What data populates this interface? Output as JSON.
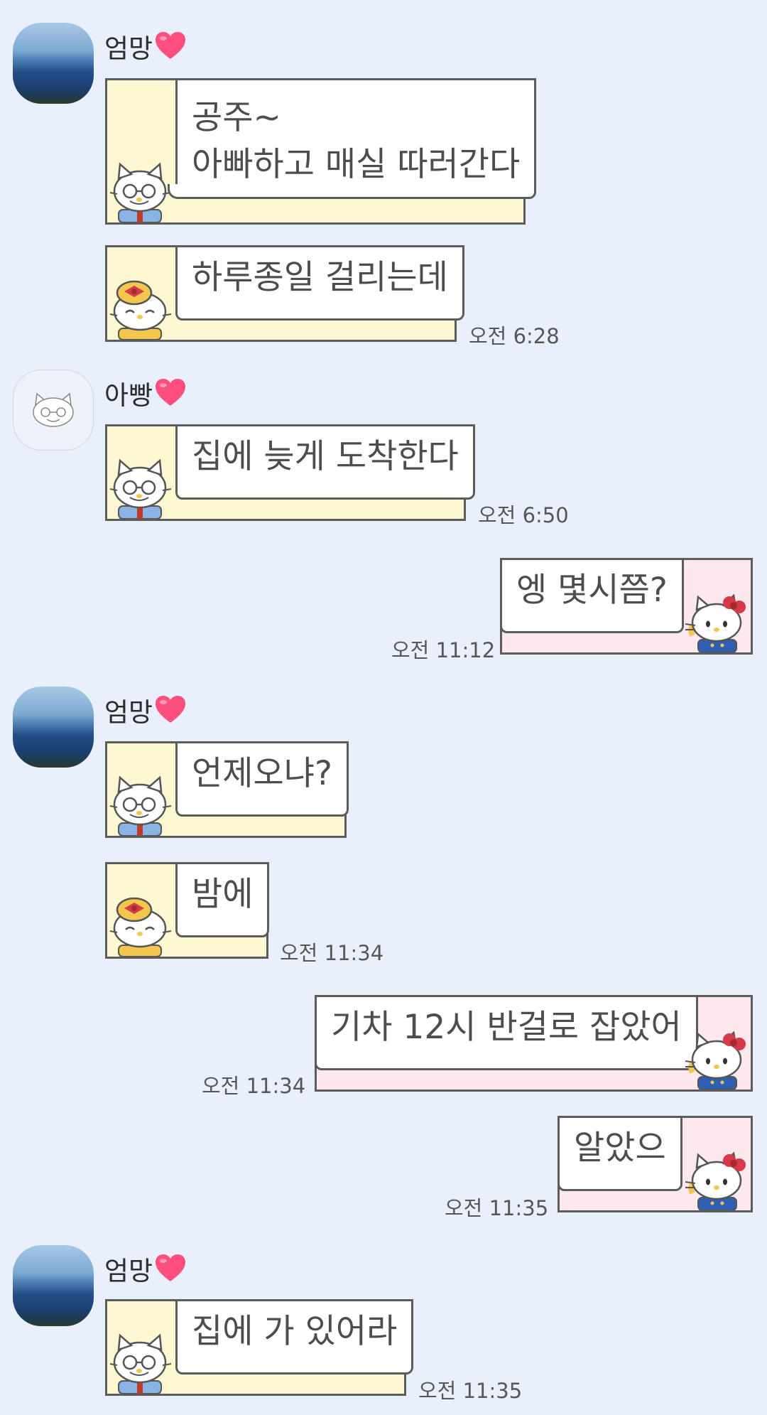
{
  "senders": {
    "mom": "엄망",
    "dad": "아빵"
  },
  "messages": [
    {
      "from": "mom",
      "text_lines": [
        "공주~",
        "아빠하고 매실 따러간다"
      ]
    },
    {
      "from": "mom",
      "text": "하루종일 걸리는데",
      "time": "오전 6:28"
    },
    {
      "from": "dad",
      "text": "집에 늦게 도착한다",
      "time": "오전 6:50"
    },
    {
      "from": "me",
      "text": "엥 몇시쯤?",
      "time": "오전 11:12"
    },
    {
      "from": "mom",
      "text": "언제오냐?"
    },
    {
      "from": "mom",
      "text": "밤에",
      "time": "오전 11:34"
    },
    {
      "from": "me",
      "text": "기차 12시 반걸로 잡았어",
      "time": "오전 11:34"
    },
    {
      "from": "me",
      "text": "알았으",
      "time": "오전 11:35"
    },
    {
      "from": "mom",
      "text": "집에 가 있어라",
      "time": "오전 11:35"
    }
  ],
  "colors": {
    "background": "#e9f0fb",
    "left_card": "#fdf7d2",
    "right_card": "#fde8ee",
    "border": "#5c5c5c",
    "heart": "#ff4f7f"
  },
  "icons": [
    "heart-emoji",
    "hello-kitty-grandpa-icon",
    "hello-kitty-grandma-icon",
    "hello-kitty-icon",
    "cat-face-icon"
  ]
}
